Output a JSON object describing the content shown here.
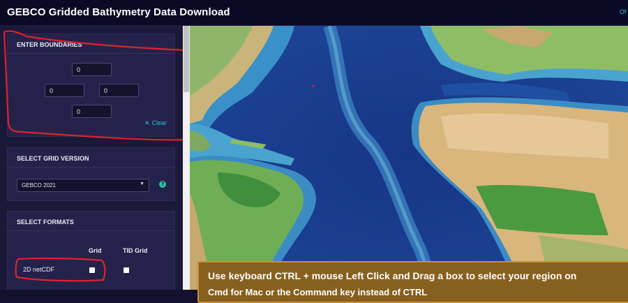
{
  "header": {
    "title": "GEBCO Gridded Bathymetry Data Download",
    "link_partial": "Of"
  },
  "boundaries": {
    "heading": "ENTER BOUNDARIES",
    "north": "0",
    "west": "0",
    "east": "0",
    "south": "0",
    "clear_label": "Clear",
    "clear_icon": "close-icon"
  },
  "grid_version": {
    "heading": "SELECT GRID VERSION",
    "selected": "GEBCO 2021",
    "help_icon": "question-circle-icon"
  },
  "formats": {
    "heading": "SELECT FORMATS",
    "columns": [
      "Grid",
      "TID Grid"
    ],
    "rows": [
      {
        "label": "2D netCDF",
        "grid": false,
        "tid_grid": false
      }
    ]
  },
  "map": {
    "instruction": "Use keyboard CTRL + mouse Left Click and Drag a box to select your region on",
    "instruction_line2": "Cmd for Mac or the Command key instead of CTRL"
  },
  "colors": {
    "accent": "#24c3d6",
    "annotation": "#e0212b",
    "banner": "#87601f"
  }
}
